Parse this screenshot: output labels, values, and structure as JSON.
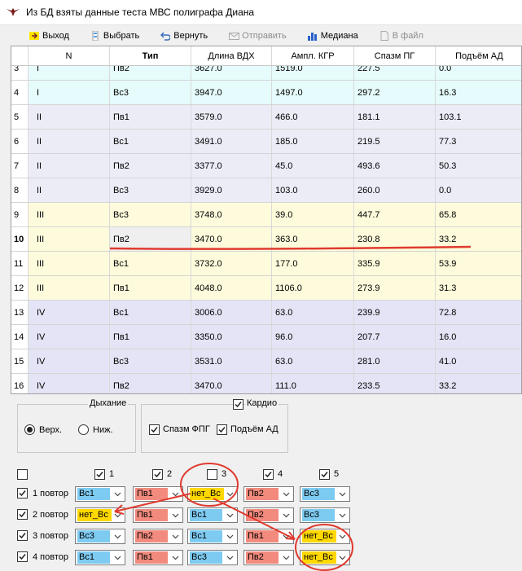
{
  "window": {
    "title": "Из БД взяты данные теста МВС полиграфа Диана"
  },
  "toolbar": {
    "exit": "Выход",
    "select": "Выбрать",
    "back": "Вернуть",
    "send": "Отправить",
    "median": "Медиана",
    "tofile": "В файл"
  },
  "table": {
    "columns": [
      "N",
      "Тип",
      "Длина ВДХ",
      "Ампл. КГР",
      "Спазм ПГ",
      "Подъём АД"
    ],
    "rows": [
      {
        "idx": "3",
        "n": "I",
        "type": "Пв2",
        "vdh": "3627.0",
        "kgr": "1519.0",
        "pg": "227.5",
        "ad": "0.0"
      },
      {
        "idx": "4",
        "n": "I",
        "type": "Вс3",
        "vdh": "3947.0",
        "kgr": "1497.0",
        "pg": "297.2",
        "ad": "16.3"
      },
      {
        "idx": "5",
        "n": "II",
        "type": "Пв1",
        "vdh": "3579.0",
        "kgr": "466.0",
        "pg": "181.1",
        "ad": "103.1"
      },
      {
        "idx": "6",
        "n": "II",
        "type": "Вс1",
        "vdh": "3491.0",
        "kgr": "185.0",
        "pg": "219.5",
        "ad": "77.3"
      },
      {
        "idx": "7",
        "n": "II",
        "type": "Пв2",
        "vdh": "3377.0",
        "kgr": "45.0",
        "pg": "493.6",
        "ad": "50.3"
      },
      {
        "idx": "8",
        "n": "II",
        "type": "Вс3",
        "vdh": "3929.0",
        "kgr": "103.0",
        "pg": "260.0",
        "ad": "0.0"
      },
      {
        "idx": "9",
        "n": "III",
        "type": "Вс3",
        "vdh": "3748.0",
        "kgr": "39.0",
        "pg": "447.7",
        "ad": "65.8"
      },
      {
        "idx": "10",
        "n": "III",
        "type": "Пв2",
        "vdh": "3470.0",
        "kgr": "363.0",
        "pg": "230.8",
        "ad": "33.2"
      },
      {
        "idx": "11",
        "n": "III",
        "type": "Вс1",
        "vdh": "3732.0",
        "kgr": "177.0",
        "pg": "335.9",
        "ad": "53.9"
      },
      {
        "idx": "12",
        "n": "III",
        "type": "Пв1",
        "vdh": "4048.0",
        "kgr": "1106.0",
        "pg": "273.9",
        "ad": "31.3"
      },
      {
        "idx": "13",
        "n": "IV",
        "type": "Вс1",
        "vdh": "3006.0",
        "kgr": "63.0",
        "pg": "239.9",
        "ad": "72.8"
      },
      {
        "idx": "14",
        "n": "IV",
        "type": "Пв1",
        "vdh": "3350.0",
        "kgr": "96.0",
        "pg": "207.7",
        "ad": "16.0"
      },
      {
        "idx": "15",
        "n": "IV",
        "type": "Вс3",
        "vdh": "3531.0",
        "kgr": "63.0",
        "pg": "281.0",
        "ad": "41.0"
      },
      {
        "idx": "16",
        "n": "IV",
        "type": "Пв2",
        "vdh": "3470.0",
        "kgr": "111.0",
        "pg": "233.5",
        "ad": "33.2"
      }
    ]
  },
  "breathing": {
    "legend": "Дыхание",
    "upper": "Верх.",
    "lower": "Ниж.",
    "selected": "Верх."
  },
  "cardio": {
    "legend": "Кардио",
    "spasm": "Спазм ФПГ",
    "bp": "Подъём АД"
  },
  "matrix": {
    "cols": [
      "1",
      "2",
      "3",
      "4",
      "5"
    ],
    "col_checked": [
      true,
      true,
      false,
      true,
      true
    ],
    "rows": [
      {
        "label": "1 повтор",
        "cells": [
          "Вс1",
          "Пв1",
          "нет_Вс",
          "Пв2",
          "Вс3"
        ]
      },
      {
        "label": "2 повтор",
        "cells": [
          "нет_Вс",
          "Пв1",
          "Вс1",
          "Пв2",
          "Вс3"
        ]
      },
      {
        "label": "3 повтор",
        "cells": [
          "Вс3",
          "Пв2",
          "Вс1",
          "Пв1",
          "нет_Вс"
        ]
      },
      {
        "label": "4 повтор",
        "cells": [
          "Вс1",
          "Пв1",
          "Вс3",
          "Пв2",
          "нет_Вс"
        ]
      }
    ]
  },
  "colors": {
    "vs": "#7ecbf2",
    "pv": "#f28b7e",
    "net": "#ffd800",
    "annotation": "#e03a2f",
    "group1": "#e6fbfb",
    "group2": "#ececf7",
    "group3": "#fdfbdc",
    "group4": "#e4e4f6"
  }
}
